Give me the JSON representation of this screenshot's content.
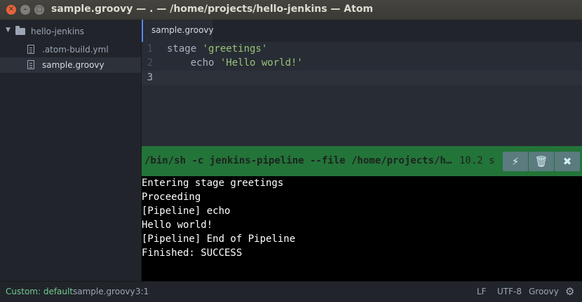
{
  "window": {
    "title": "sample.groovy — . — /home/projects/hello-jenkins — Atom"
  },
  "tree": {
    "root": "hello-jenkins",
    "files": [
      {
        "label": ".atom-build.yml"
      },
      {
        "label": "sample.groovy"
      }
    ]
  },
  "tabs": [
    {
      "label": "sample.groovy"
    }
  ],
  "editor": {
    "line_numbers": [
      "1",
      "2",
      "3"
    ],
    "lines": [
      {
        "plain": "stage ",
        "str": "'greetings'"
      },
      {
        "plain": "    echo ",
        "str": "'Hello world!'"
      },
      {
        "plain": "",
        "str": ""
      }
    ]
  },
  "build": {
    "command": "/bin/sh -c jenkins-pipeline --file /home/projects/h…",
    "time": "10.2 s",
    "output": [
      "Entering stage greetings",
      "Proceeding",
      "[Pipeline] echo",
      "Hello world!",
      "[Pipeline] End of Pipeline",
      "Finished: SUCCESS"
    ]
  },
  "status": {
    "target": "Custom: default",
    "file": "sample.groovy",
    "cursor": "3:1",
    "line_ending": "LF",
    "encoding": "UTF-8",
    "grammar": "Groovy"
  }
}
